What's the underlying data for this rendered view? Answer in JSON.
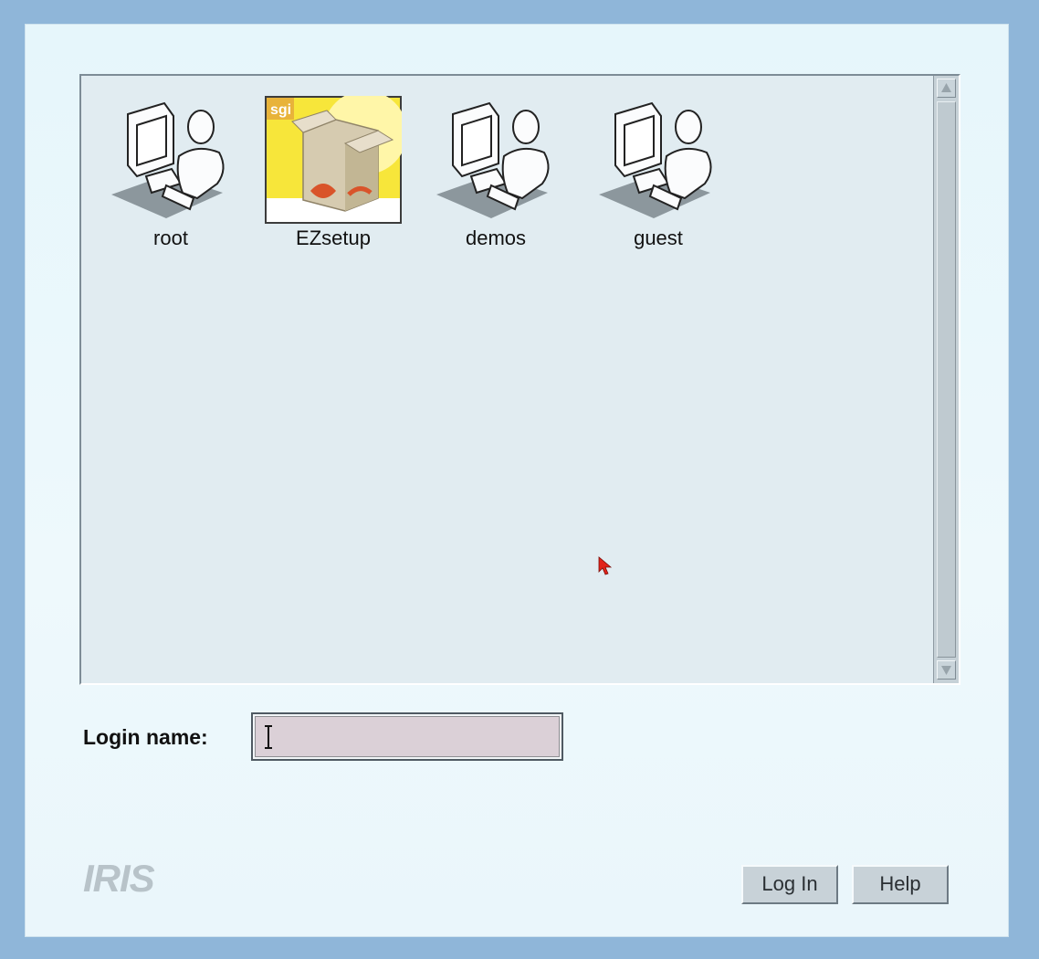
{
  "users": [
    {
      "name": "root",
      "icon": "workstation-user-icon"
    },
    {
      "name": "EZsetup",
      "icon": "sgi-box-icon",
      "icon_text": "sgi"
    },
    {
      "name": "demos",
      "icon": "workstation-user-icon"
    },
    {
      "name": "guest",
      "icon": "workstation-user-icon"
    }
  ],
  "login": {
    "label": "Login name:",
    "value": ""
  },
  "logo": "IRIS",
  "buttons": {
    "login": "Log In",
    "help": "Help"
  },
  "colors": {
    "desktop": "#8fb6d9",
    "window": "#e6f6fb",
    "input_bg": "#dbd0d7",
    "box_yellow": "#f7e63a",
    "cursor": "#e2231a"
  }
}
